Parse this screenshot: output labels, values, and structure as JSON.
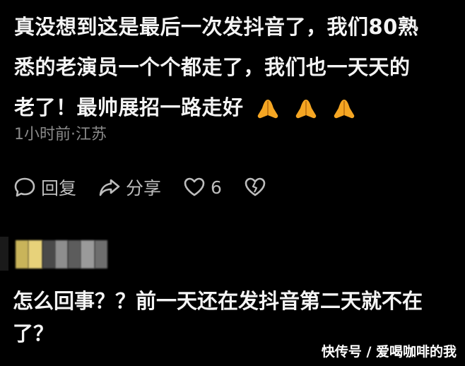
{
  "comment": {
    "text_line1": "真没想到这是最后一次发抖音了，我们80熟",
    "text_line2": "悉的老演员一个个都走了，我们也一天天的",
    "text_line3": "老了！最帅展招一路走好",
    "emojis": [
      "pray-icon",
      "pray-icon",
      "pray-icon"
    ],
    "meta": "1小时前·江苏"
  },
  "actions": {
    "reply_label": "回复",
    "share_label": "分享",
    "like_count": "6"
  },
  "reply": {
    "text": "怎么回事？？前一天还在发抖音第二天就不在了？"
  },
  "watermark": "快传号 / 爱喝咖啡的我",
  "colors": {
    "background": "#000000",
    "text": "#f4f4f4",
    "meta": "#8a8a8a",
    "icon": "#bdbdbd",
    "emoji": "#f5a623"
  }
}
